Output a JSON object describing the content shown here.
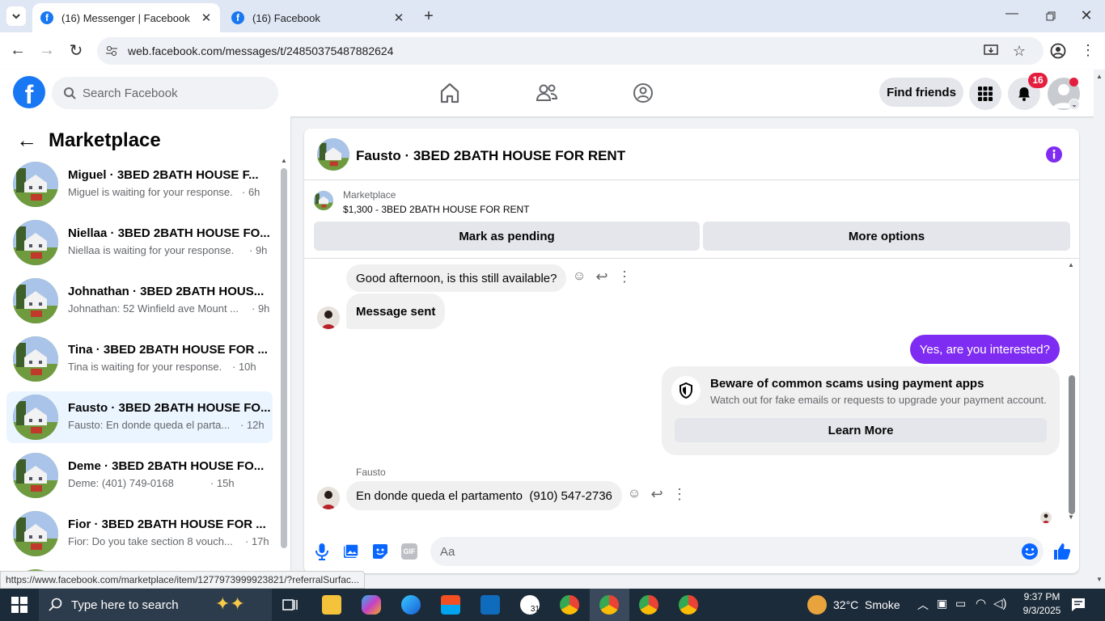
{
  "browser": {
    "tabs": [
      {
        "title": "(16) Messenger | Facebook"
      },
      {
        "title": "(16) Facebook"
      }
    ],
    "url": "web.facebook.com/messages/t/24850375487882624",
    "status_url": "https://www.facebook.com/marketplace/item/1277973999923821/?referralSurfac..."
  },
  "fb_header": {
    "logo": "f",
    "search_placeholder": "Search Facebook",
    "find_friends": "Find friends",
    "notification_count": "16"
  },
  "sidebar": {
    "title": "Marketplace",
    "conversations": [
      {
        "title": "Miguel · 3BED 2BATH HOUSE F...",
        "preview": "Miguel is waiting for your response.",
        "time": "· 6h"
      },
      {
        "title": "Niellaa · 3BED 2BATH HOUSE FO...",
        "preview": "Niellaa is waiting for your response.",
        "time": "· 9h"
      },
      {
        "title": "Johnathan · 3BED 2BATH HOUS...",
        "preview": "Johnathan: 52 Winfield ave Mount ...",
        "time": "· 9h"
      },
      {
        "title": "Tina · 3BED 2BATH HOUSE FOR ...",
        "preview": "Tina is waiting for your response.",
        "time": "· 10h"
      },
      {
        "title": "Fausto · 3BED 2BATH HOUSE FO...",
        "preview": "Fausto: En donde queda el parta...",
        "time": "· 12h"
      },
      {
        "title": "Deme · 3BED 2BATH HOUSE FO...",
        "preview": "Deme: (401) 749-0168",
        "time": "· 15h"
      },
      {
        "title": "Fior · 3BED 2BATH HOUSE FOR ...",
        "preview": "Fior: Do you take section 8 vouch...",
        "time": "· 17h"
      }
    ]
  },
  "chat": {
    "title": "Fausto · 3BED 2BATH HOUSE FOR RENT",
    "listing_source": "Marketplace",
    "listing_title": "$1,300 - 3BED 2BATH HOUSE FOR RENT",
    "mark_pending": "Mark as pending",
    "more_options": "More options",
    "messages": {
      "m1": "Good afternoon, is this still available?",
      "m2": "Message sent",
      "m3": "Yes, are you interested?",
      "m4_sender": "Fausto",
      "m4": "En donde queda el partamento  (910) 547-2736"
    },
    "scam_notice": {
      "title": "Beware of common scams using payment apps",
      "body": "Watch out for fake emails or requests to upgrade your payment account.",
      "button": "Learn More"
    },
    "composer_placeholder": "Aa",
    "gif_label": "GIF"
  },
  "taskbar": {
    "search_placeholder": "Type here to search",
    "weather": "32°C  Smoke",
    "time": "9:37 PM",
    "date": "9/3/2025",
    "badge_calendar": "31"
  },
  "colors": {
    "fb_blue": "#1877f2",
    "messenger_purple": "#7f2cf2",
    "badge_red": "#e41e3f"
  }
}
